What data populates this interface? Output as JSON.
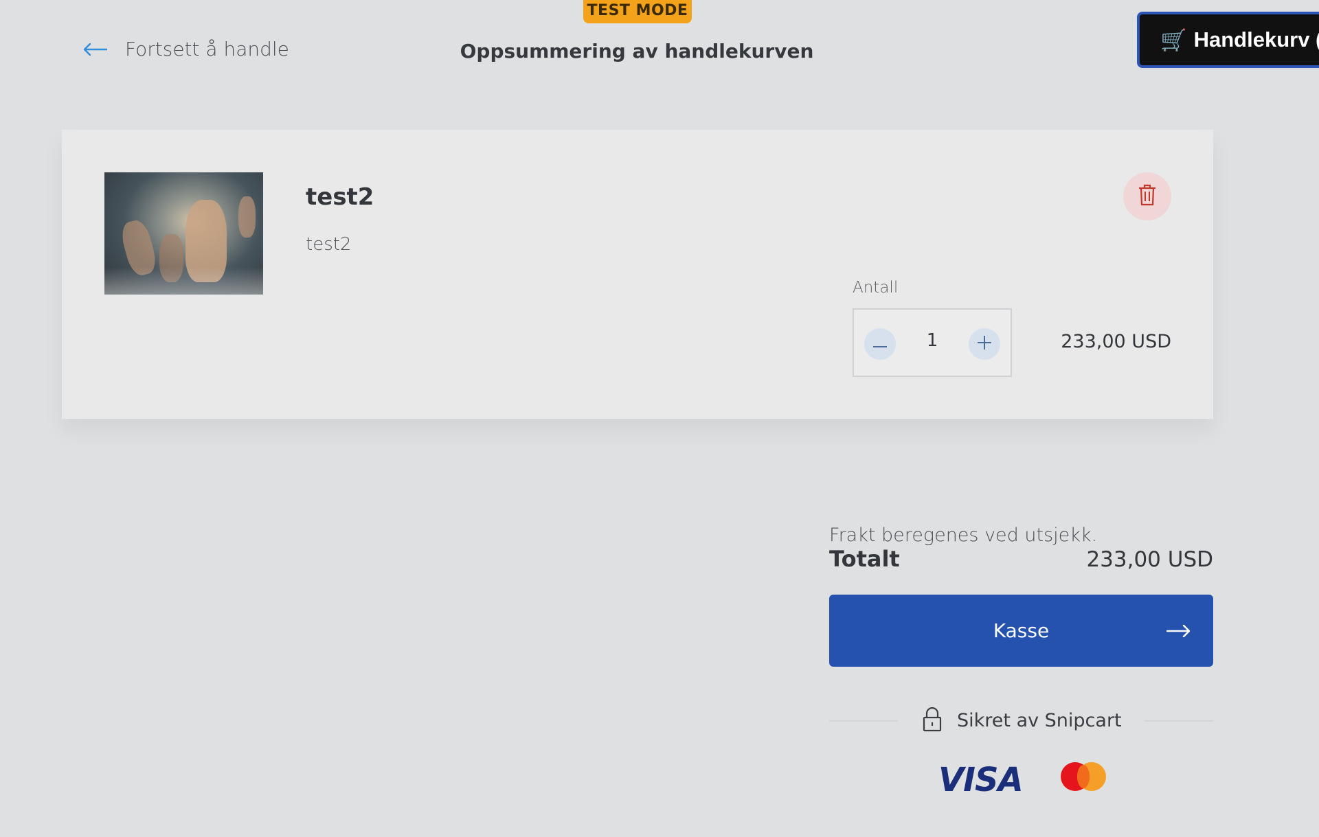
{
  "badge": {
    "test_mode": "TEST MODE"
  },
  "header": {
    "back_label": "Fortsett å handle",
    "title": "Oppsummering av handlekurven",
    "cart_button": "Handlekurv ()",
    "cart_icon": "🛒"
  },
  "item": {
    "name": "test2",
    "description": "test2",
    "quantity_label": "Antall",
    "quantity": "1",
    "price": "233,00 USD",
    "thumbnail_icon": "painting-thumbnail"
  },
  "summary": {
    "shipping_note": "Frakt beregenes ved utsjekk.",
    "total_label": "Totalt",
    "total_value": "233,00 USD",
    "checkout_label": "Kasse",
    "secured_label": "Sikret av Snipcart"
  },
  "payment": {
    "visa": "VISA",
    "mastercard_icon": "mastercard-logo"
  },
  "colors": {
    "background": "#dfe0e2",
    "accent": "#2452ae",
    "badge": "#f5a21b",
    "delete_bg": "#f0d6d6",
    "delete_icon": "#c0392b"
  }
}
